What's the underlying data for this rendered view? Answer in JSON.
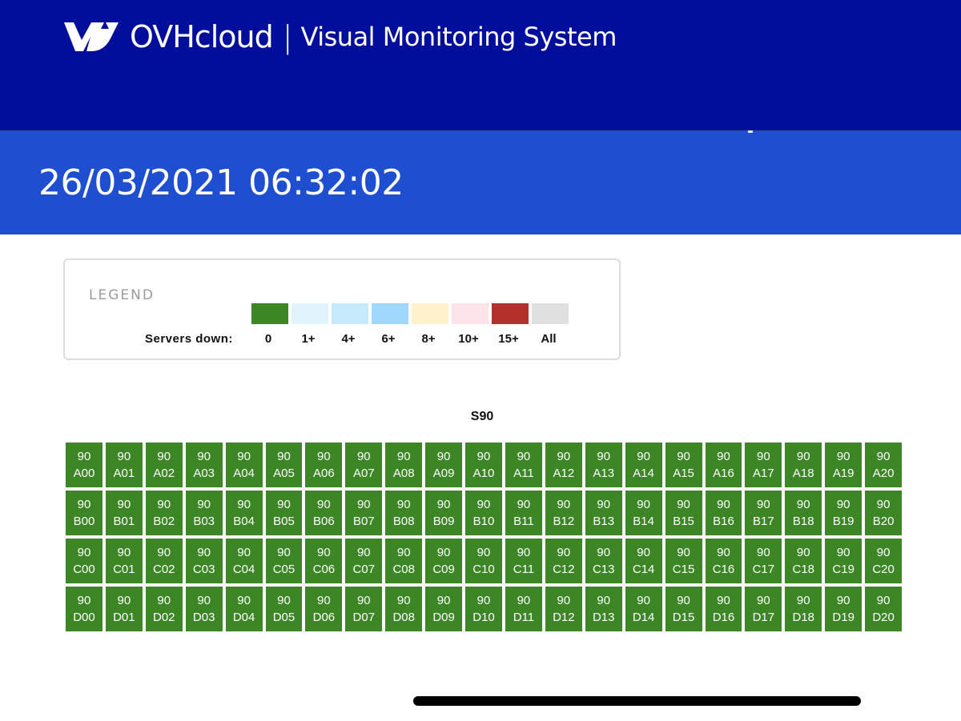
{
  "header": {
    "brand": "OVHcloud",
    "separator": "|",
    "subtitle": "Visual Monitoring System",
    "logo_icon": "ovh-logo-icon",
    "background_color": "#000e9c"
  },
  "timestamp": "26/03/2021 06:32:02",
  "legend": {
    "title": "LEGEND",
    "servers_down_label": "Servers down:",
    "items": [
      {
        "label": "0",
        "color": "#3c8626"
      },
      {
        "label": "1+",
        "color": "#e1f4fd"
      },
      {
        "label": "4+",
        "color": "#c6e9fb"
      },
      {
        "label": "6+",
        "color": "#9fd8fa"
      },
      {
        "label": "8+",
        "color": "#fdf2cc"
      },
      {
        "label": "10+",
        "color": "#fde3e8"
      },
      {
        "label": "15+",
        "color": "#b4302a"
      },
      {
        "label": "All",
        "color": "#e0e0e0"
      }
    ]
  },
  "group": {
    "title": "S90",
    "status_color": "#3c8626",
    "rows": [
      {
        "prefix": "A",
        "racks": [
          "A00",
          "A01",
          "A02",
          "A03",
          "A04",
          "A05",
          "A06",
          "A07",
          "A08",
          "A09",
          "A10",
          "A11",
          "A12",
          "A13",
          "A14",
          "A15",
          "A16",
          "A17",
          "A18",
          "A19",
          "A20"
        ]
      },
      {
        "prefix": "B",
        "racks": [
          "B00",
          "B01",
          "B02",
          "B03",
          "B04",
          "B05",
          "B06",
          "B07",
          "B08",
          "B09",
          "B10",
          "B11",
          "B12",
          "B13",
          "B14",
          "B15",
          "B16",
          "B17",
          "B18",
          "B19",
          "B20"
        ]
      },
      {
        "prefix": "C",
        "racks": [
          "C00",
          "C01",
          "C02",
          "C03",
          "C04",
          "C05",
          "C06",
          "C07",
          "C08",
          "C09",
          "C10",
          "C11",
          "C12",
          "C13",
          "C14",
          "C15",
          "C16",
          "C17",
          "C18",
          "C19",
          "C20"
        ]
      },
      {
        "prefix": "D",
        "racks": [
          "D00",
          "D01",
          "D02",
          "D03",
          "D04",
          "D05",
          "D06",
          "D07",
          "D08",
          "D09",
          "D10",
          "D11",
          "D12",
          "D13",
          "D14",
          "D15",
          "D16",
          "D17",
          "D18",
          "D19",
          "D20"
        ]
      }
    ],
    "rack_prefix": "90"
  }
}
